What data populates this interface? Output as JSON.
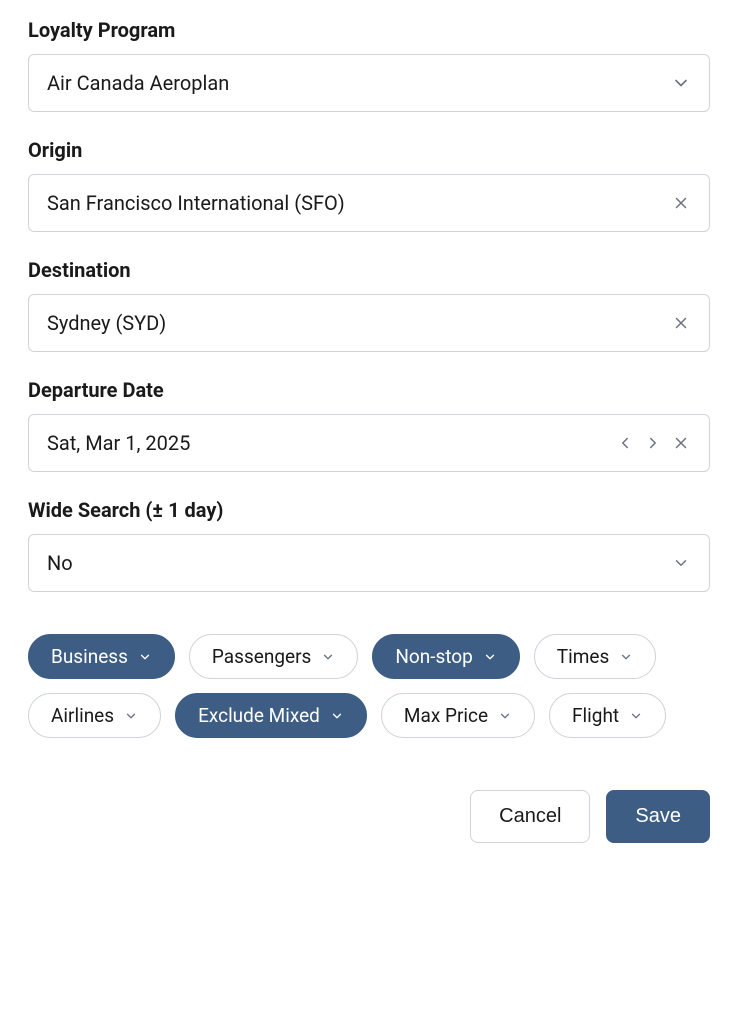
{
  "form": {
    "loyalty": {
      "label": "Loyalty Program",
      "value": "Air Canada Aeroplan"
    },
    "origin": {
      "label": "Origin",
      "value": "San Francisco International (SFO)"
    },
    "destination": {
      "label": "Destination",
      "value": "Sydney (SYD)"
    },
    "departure": {
      "label": "Departure Date",
      "value": "Sat, Mar 1, 2025"
    },
    "wide_search": {
      "label": "Wide Search (± 1 day)",
      "value": "No"
    }
  },
  "chips": {
    "business": "Business",
    "passengers": "Passengers",
    "nonstop": "Non-stop",
    "times": "Times",
    "airlines": "Airlines",
    "exclude_mixed": "Exclude Mixed",
    "max_price": "Max Price",
    "flight": "Flight"
  },
  "buttons": {
    "cancel": "Cancel",
    "save": "Save"
  }
}
